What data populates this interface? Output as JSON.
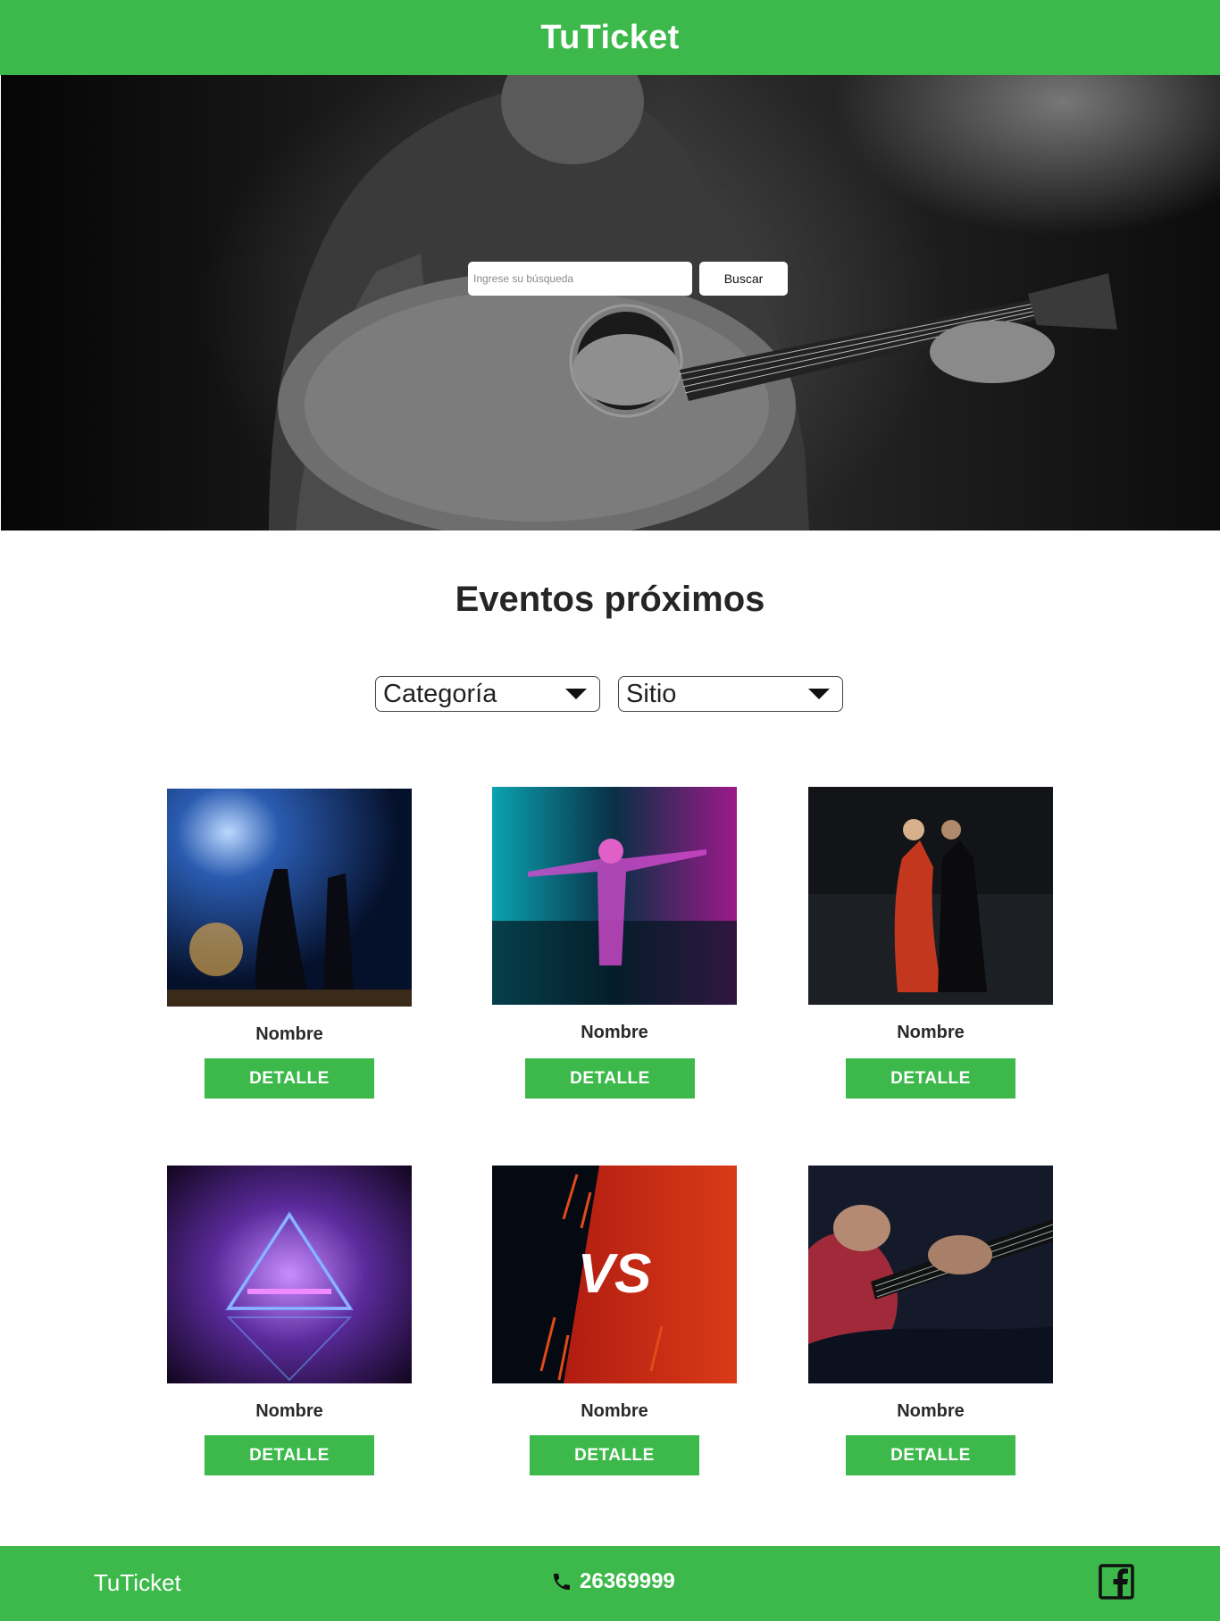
{
  "header": {
    "brand": "TuTicket"
  },
  "hero": {
    "search_placeholder": "Ingrese su búsqueda",
    "search_button": "Buscar"
  },
  "section": {
    "title": "Eventos próximos"
  },
  "filters": [
    {
      "label": "Categoría"
    },
    {
      "label": "Sitio"
    }
  ],
  "events": [
    {
      "name": "Nombre",
      "button": "DETALLE"
    },
    {
      "name": "Nombre",
      "button": "DETALLE"
    },
    {
      "name": "Nombre",
      "button": "DETALLE"
    },
    {
      "name": "Nombre",
      "button": "DETALLE"
    },
    {
      "name": "Nombre",
      "button": "DETALLE"
    },
    {
      "name": "Nombre",
      "button": "DETALLE"
    }
  ],
  "footer": {
    "brand": "TuTicket",
    "phone": "26369999"
  },
  "colors": {
    "brand_green": "#3cb94a"
  },
  "icons": [
    "phone-icon",
    "facebook-icon",
    "dropdown-caret-icon"
  ]
}
